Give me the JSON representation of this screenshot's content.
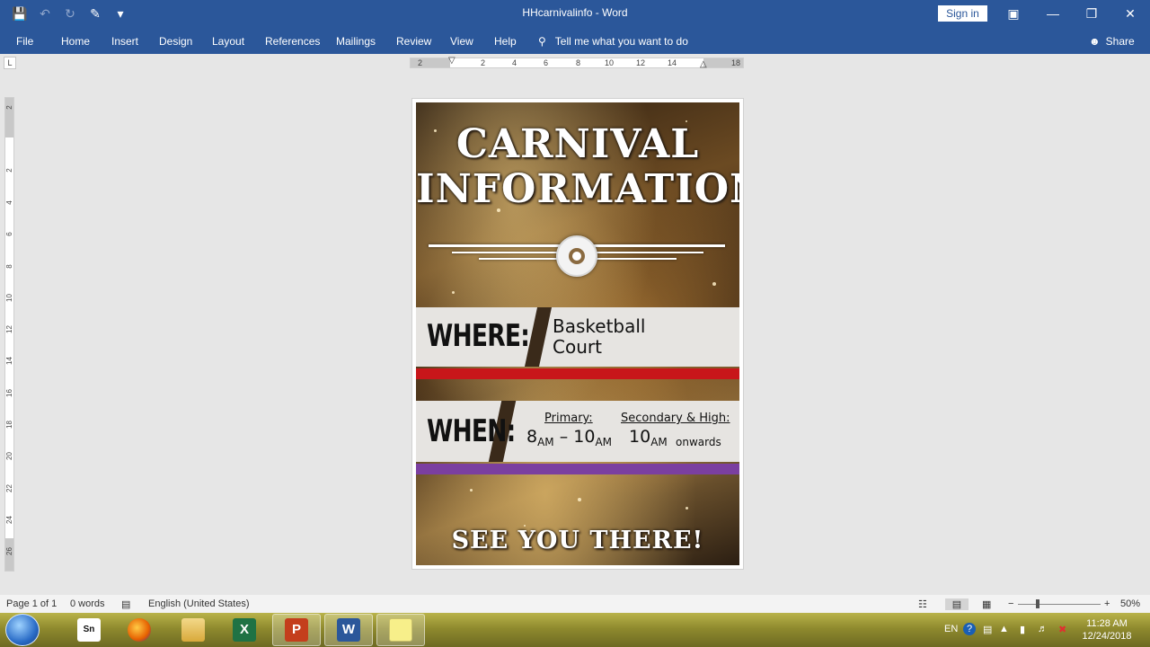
{
  "window": {
    "title": "HHcarnivalinfo - Word",
    "sign_in": "Sign in"
  },
  "ribbon": {
    "tabs": [
      "File",
      "Home",
      "Insert",
      "Design",
      "Layout",
      "References",
      "Mailings",
      "Review",
      "View",
      "Help"
    ],
    "tell_me": "Tell me what you want to do",
    "share": "Share"
  },
  "ruler": {
    "horizontal_ticks": [
      "2",
      "2",
      "4",
      "6",
      "8",
      "10",
      "12",
      "14",
      "18"
    ],
    "vertical_ticks": [
      "2",
      "2",
      "4",
      "6",
      "8",
      "10",
      "12",
      "14",
      "16",
      "18",
      "20",
      "22",
      "24",
      "26"
    ],
    "corner": "L"
  },
  "poster": {
    "title_line1": "CARNIVAL",
    "title_line2": "INFORMATION",
    "where_label": "WHERE:",
    "where_line1": "Basketball",
    "where_line2": "Court",
    "when_label": "WHEN:",
    "primary_heading": "Primary:",
    "primary_start": "8",
    "primary_start_unit": "AM",
    "primary_dash": "–",
    "primary_end": "10",
    "primary_end_unit": "AM",
    "secondary_heading": "Secondary & High:",
    "secondary_time": "10",
    "secondary_unit": "AM",
    "secondary_suffix": "onwards",
    "footer": "SEE YOU THERE!",
    "colors": {
      "red_stripe": "#c8161a",
      "purple_stripe": "#7b3fa0"
    }
  },
  "status": {
    "page": "Page 1 of 1",
    "words": "0 words",
    "language": "English (United States)",
    "zoom": "50%"
  },
  "taskbar": {
    "apps": [
      "Snagit",
      "Firefox",
      "File Explorer",
      "Excel",
      "PowerPoint",
      "Word",
      "Sticky Notes"
    ],
    "lang": "EN",
    "time": "11:28 AM",
    "date": "12/24/2018"
  }
}
